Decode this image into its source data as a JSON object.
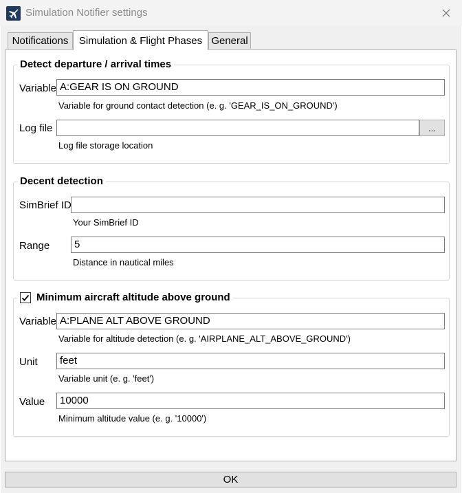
{
  "window": {
    "title": "Simulation Notifier settings"
  },
  "tabs": [
    {
      "label": "Notifications"
    },
    {
      "label": "Simulation & Flight Phases"
    },
    {
      "label": "General"
    }
  ],
  "groups": {
    "times": {
      "title": "Detect departure / arrival times",
      "variable": {
        "label": "Variable",
        "value": "A:GEAR IS ON GROUND",
        "hint": "Variable for ground contact detection (e. g. 'GEAR_IS_ON_GROUND')"
      },
      "log_file": {
        "label": "Log file",
        "value": "",
        "browse_label": "...",
        "hint": "Log file storage location"
      }
    },
    "decent": {
      "title": "Decent detection",
      "simbrief": {
        "label": "SimBrief ID",
        "value": "",
        "hint": "Your SimBrief ID"
      },
      "range": {
        "label": "Range",
        "value": "5",
        "hint": "Distance in nautical miles"
      }
    },
    "altitude": {
      "title": "Minimum aircraft altitude above ground",
      "checked": true,
      "variable": {
        "label": "Variable",
        "value": "A:PLANE ALT ABOVE GROUND",
        "hint": "Variable for altitude detection (e. g. 'AIRPLANE_ALT_ABOVE_GROUND')"
      },
      "unit": {
        "label": "Unit",
        "value": "feet",
        "hint": "Variable unit (e. g. 'feet')"
      },
      "value": {
        "label": "Value",
        "value": "10000",
        "hint": "Minimum altitude value (e. g. '10000')"
      }
    }
  },
  "ok_label": "OK",
  "colors": {
    "app_icon": "#1f3a5f",
    "title_text": "#8a8a8a",
    "window_bg": "#f0f0f0"
  }
}
